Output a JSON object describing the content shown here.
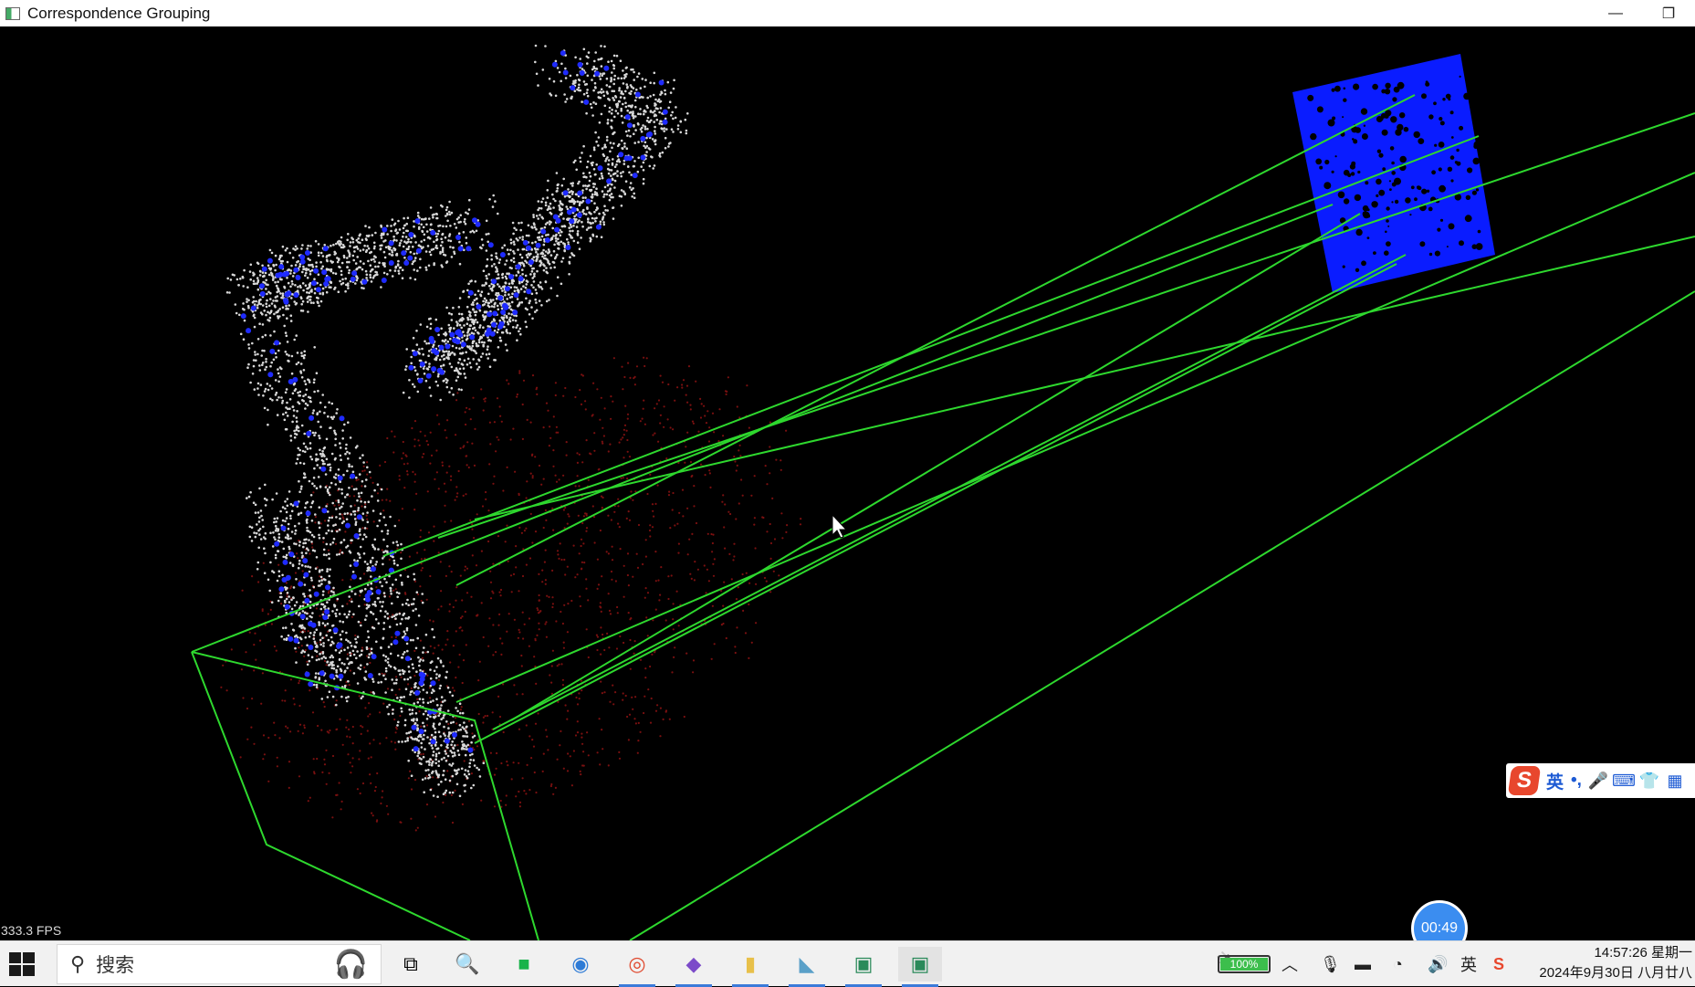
{
  "window": {
    "title": "Correspondence Grouping",
    "minimize_glyph": "—",
    "restore_glyph": "❐"
  },
  "viewport": {
    "fps": "333.3 FPS",
    "colors": {
      "scene_cloud": "#d8d8d8",
      "keypoints": "#1f2bff",
      "model_cloud": "#0a1cff",
      "correspondence_lines": "#2ed82e",
      "bounding_box": "#2ed82e",
      "scene_shadow": "#7a1010"
    }
  },
  "ime_toolbar": {
    "logo": "S",
    "language": "英",
    "punct": "•,",
    "icons": [
      "microphone-icon",
      "keyboard-icon",
      "shirt-icon",
      "grid-icon"
    ]
  },
  "recorder": {
    "time": "00:49"
  },
  "taskbar": {
    "search_placeholder": "搜索",
    "apps": [
      {
        "name": "task-view",
        "glyph": "⧉"
      },
      {
        "name": "search-tool",
        "glyph": "🔍"
      },
      {
        "name": "green-app",
        "glyph": "■"
      },
      {
        "name": "edge",
        "glyph": "◉"
      },
      {
        "name": "chrome",
        "glyph": "◎"
      },
      {
        "name": "visual-studio",
        "glyph": "◆"
      },
      {
        "name": "file-explorer",
        "glyph": "▮"
      },
      {
        "name": "paint",
        "glyph": "◣"
      },
      {
        "name": "window-a",
        "glyph": "▣"
      },
      {
        "name": "window-b",
        "glyph": "▣"
      }
    ],
    "battery": "100%",
    "time": "14:57:26 星期一",
    "date": "2024年9月30日 八月廿八"
  }
}
